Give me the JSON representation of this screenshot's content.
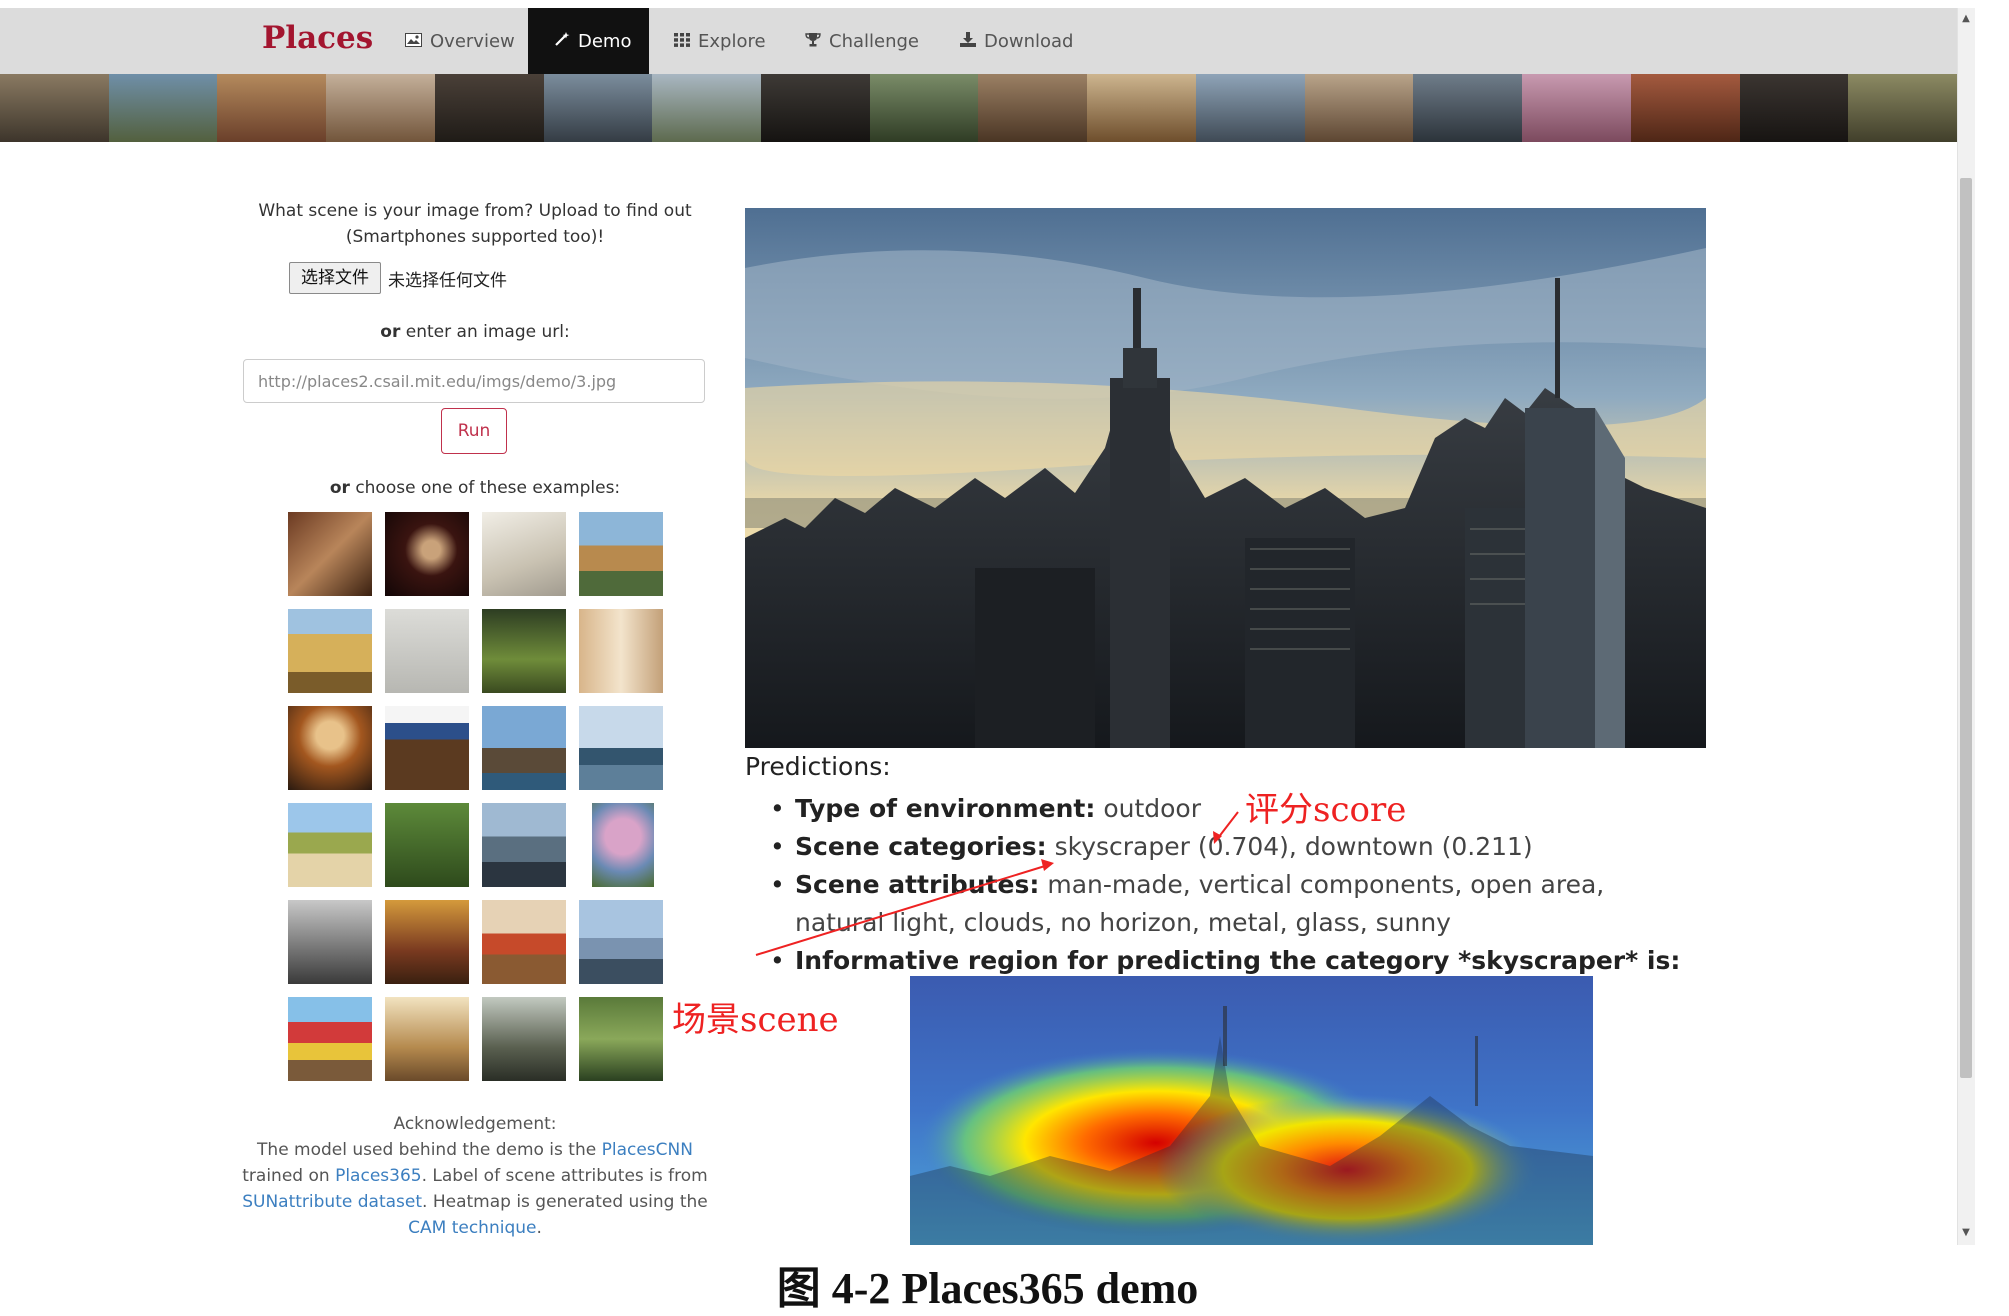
{
  "navbar": {
    "brand": "Places",
    "items": [
      {
        "label": "Overview",
        "icon": "image-icon"
      },
      {
        "label": "Demo",
        "icon": "magic-wand-icon",
        "active": true
      },
      {
        "label": "Explore",
        "icon": "grid-icon"
      },
      {
        "label": "Challenge",
        "icon": "trophy-icon"
      },
      {
        "label": "Download",
        "icon": "download-icon"
      }
    ],
    "colors": {
      "bar": "#dcdcdc",
      "active": "#111111",
      "brand": "#a3152f"
    }
  },
  "upload": {
    "question_line1": "What scene is your image from? Upload to find out",
    "question_line2": "(Smartphones supported too)!",
    "choose_file_label": "选择文件",
    "no_file_text": "未选择任何文件",
    "or_word": "or",
    "url_prompt": "enter an image url:",
    "url_placeholder": "http://places2.csail.mit.edu/imgs/demo/3.jpg",
    "run_label": "Run",
    "examples_prompt": "choose one of these examples:",
    "accent_color": "#c0314c"
  },
  "examples": [
    "restaurant",
    "speaker",
    "bathroom",
    "aqueduct",
    "hayfield",
    "person-sitting",
    "forest-path",
    "corridor",
    "conference-room",
    "laundromat",
    "sea-arch",
    "bridge",
    "beach",
    "forest",
    "skyline",
    "tree-garden",
    "crowd",
    "food-court",
    "bedroom",
    "ocean-person",
    "playground",
    "lobby",
    "patio",
    "pond-garden"
  ],
  "acknowledgement": {
    "heading": "Acknowledgement:",
    "line1_pre": "The model used behind the demo is the ",
    "link_placescnn": "PlacesCNN",
    "line2_pre": "trained on ",
    "link_places365": "Places365",
    "line2_post": ". Label of scene attributes is from",
    "link_sun": "SUNattribute dataset",
    "line3_post": ". Heatmap is generated using the",
    "link_cam": "CAM technique",
    "line4_post": ".",
    "link_color": "#3c7fc0"
  },
  "predictions": {
    "title": "Predictions",
    "title_suffix": ":",
    "env_label": "Type of environment:",
    "env_value": "outdoor",
    "cat_label": "Scene categories:",
    "cat_value": "skyscraper (0.704), downtown (0.211)",
    "attr_label": "Scene attributes:",
    "attr_value": "man-made, vertical components, open area, natural light, clouds, no horizon, metal, glass, sunny",
    "region_label": "Informative region for predicting the category *skyscraper* is:"
  },
  "annotations": {
    "score": "评分score",
    "scene": "场景scene",
    "color": "#ee2222"
  },
  "caption": "图 4-2 Places365 demo"
}
